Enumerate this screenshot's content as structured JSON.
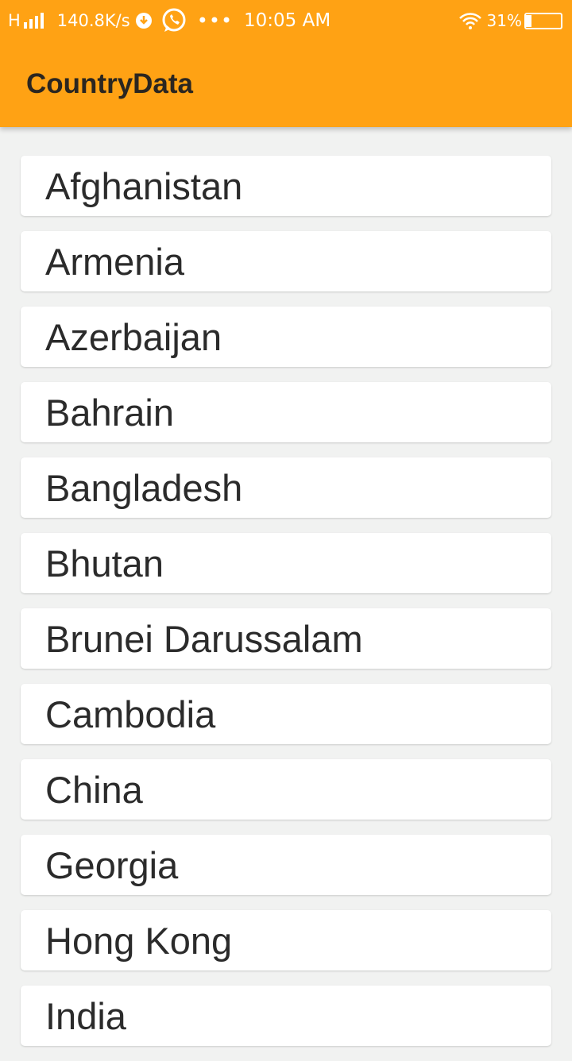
{
  "status_bar": {
    "network_type": "H",
    "net_speed": "140.8K/s",
    "more": "•••",
    "time": "10:05 AM",
    "battery_percent": "31%",
    "battery_level": 0.31,
    "icons": [
      "signal-icon",
      "download-icon",
      "whatsapp-icon",
      "more-icon",
      "wifi-icon",
      "battery-icon"
    ]
  },
  "app_bar": {
    "title": "CountryData",
    "background_color": "#ffa214"
  },
  "countries": [
    "Afghanistan",
    "Armenia",
    "Azerbaijan",
    "Bahrain",
    "Bangladesh",
    "Bhutan",
    "Brunei Darussalam",
    "Cambodia",
    "China",
    "Georgia",
    "Hong Kong",
    "India"
  ]
}
